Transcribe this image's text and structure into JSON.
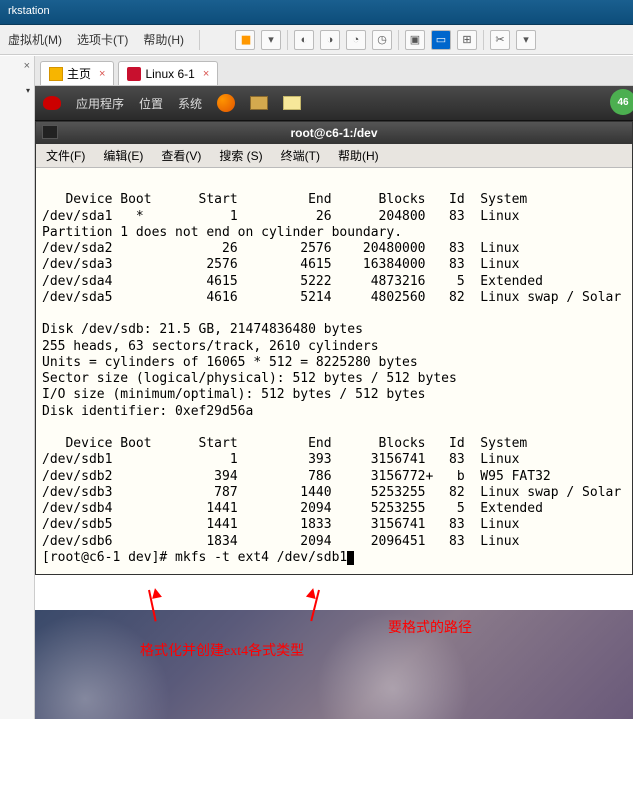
{
  "title_bar": "rkstation",
  "vm_menu": {
    "vm": "虚拟机(M)",
    "tabs": "选项卡(T)",
    "help": "帮助(H)"
  },
  "tabs": {
    "home": "主页",
    "linux": "Linux 6-1"
  },
  "gnome_menu": {
    "apps": "应用程序",
    "places": "位置",
    "system": "系统"
  },
  "green_badge": "46",
  "term_title": "root@c6-1:/dev",
  "term_menu": {
    "file": "文件(F)",
    "edit": "编辑(E)",
    "view": "查看(V)",
    "search": "搜索 (S)",
    "terminal": "终端(T)",
    "help": "帮助(H)"
  },
  "term_content": "\n   Device Boot      Start         End      Blocks   Id  System\n/dev/sda1   *           1          26      204800   83  Linux\nPartition 1 does not end on cylinder boundary.\n/dev/sda2              26        2576    20480000   83  Linux\n/dev/sda3            2576        4615    16384000   83  Linux\n/dev/sda4            4615        5222     4873216    5  Extended\n/dev/sda5            4616        5214     4802560   82  Linux swap / Solar\n\nDisk /dev/sdb: 21.5 GB, 21474836480 bytes\n255 heads, 63 sectors/track, 2610 cylinders\nUnits = cylinders of 16065 * 512 = 8225280 bytes\nSector size (logical/physical): 512 bytes / 512 bytes\nI/O size (minimum/optimal): 512 bytes / 512 bytes\nDisk identifier: 0xef29d56a\n\n   Device Boot      Start         End      Blocks   Id  System\n/dev/sdb1               1         393     3156741   83  Linux\n/dev/sdb2             394         786     3156772+   b  W95 FAT32\n/dev/sdb3             787        1440     5253255   82  Linux swap / Solar\n/dev/sdb4            1441        2094     5253255    5  Extended\n/dev/sdb5            1441        1833     3156741   83  Linux\n/dev/sdb6            1834        2094     2096451   83  Linux\n[root@c6-1 dev]# mkfs -t ext4 /dev/sdb1",
  "annotations": {
    "left": "格式化并创建ext4各式类型",
    "right": "要格式的路径"
  }
}
